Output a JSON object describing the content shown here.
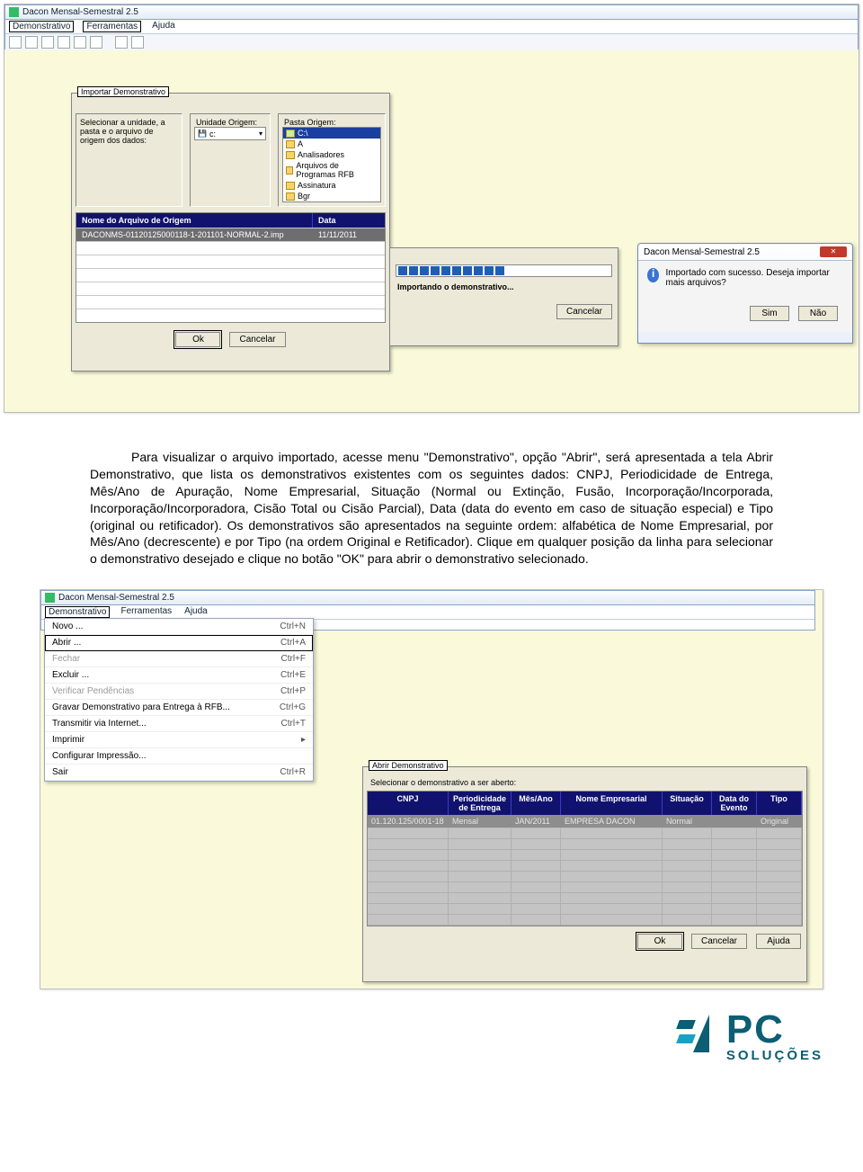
{
  "app": {
    "title": "Dacon Mensal-Semestral 2.5",
    "menus": [
      "Demonstrativo",
      "Ferramentas",
      "Ajuda"
    ]
  },
  "import_dialog": {
    "title": "Importar Demonstrativo",
    "hint": "Selecionar a unidade, a pasta e o arquivo de origem dos dados:",
    "unit_label": "Unidade Origem:",
    "unit_value": "c:",
    "folder_label": "Pasta Origem:",
    "folders": [
      "C:\\",
      "A",
      "Analisadores",
      "Arquivos de Programas RFB",
      "Assinatura",
      "Bgr"
    ],
    "table_headers": [
      "Nome do Arquivo de Origem",
      "Data"
    ],
    "file_name": "DACONMS-01120125000118-1-201101-NORMAL-2.imp",
    "file_date": "11/11/2011",
    "ok": "Ok",
    "cancel": "Cancelar"
  },
  "progress_dialog": {
    "status": "Importando o demonstrativo...",
    "cancel": "Cancelar"
  },
  "result_dialog": {
    "title": "Dacon Mensal-Semestral 2.5",
    "message": "Importado com sucesso. Deseja importar mais arquivos?",
    "yes": "Sim",
    "no": "Não"
  },
  "paragraph": "Para visualizar o arquivo importado, acesse menu \"Demonstrativo\", opção \"Abrir\", será apresentada a tela Abrir Demonstrativo, que lista os demonstrativos existentes com os seguintes dados: CNPJ, Periodicidade de Entrega, Mês/Ano de Apuração, Nome Empresarial, Situação (Normal ou Extinção, Fusão, Incorporação/Incorporada, Incorporação/Incorporadora, Cisão Total ou Cisão Parcial), Data (data do evento em caso de situação especial) e Tipo (original ou retificador). Os demonstrativos são apresentados na seguinte ordem: alfabética de Nome Empresarial, por Mês/Ano (decrescente) e por Tipo (na ordem Original e Retificador). Clique em qualquer posição da linha para selecionar o demonstrativo desejado e clique no botão \"OK\" para abrir o demonstrativo selecionado.",
  "menu_popup": {
    "items": [
      {
        "label": "Novo ...",
        "shortcut": "Ctrl+N",
        "disabled": false
      },
      {
        "label": "Abrir ...",
        "shortcut": "Ctrl+A",
        "disabled": false,
        "boxed": true
      },
      {
        "label": "Fechar",
        "shortcut": "Ctrl+F",
        "disabled": true
      },
      {
        "label": "Excluir ...",
        "shortcut": "Ctrl+E",
        "disabled": false
      },
      {
        "label": "Verificar Pendências",
        "shortcut": "Ctrl+P",
        "disabled": true
      },
      {
        "label": "Gravar Demonstrativo para Entrega à RFB...",
        "shortcut": "Ctrl+G",
        "disabled": false
      },
      {
        "label": "Transmitir via Internet...",
        "shortcut": "Ctrl+T",
        "disabled": false
      },
      {
        "label": "Imprimir",
        "shortcut": "▸",
        "disabled": false
      },
      {
        "label": "Configurar Impressão...",
        "shortcut": "",
        "disabled": false
      },
      {
        "label": "Sair",
        "shortcut": "Ctrl+R",
        "disabled": false
      }
    ]
  },
  "open_dialog": {
    "title": "Abrir Demonstrativo",
    "hint": "Selecionar o demonstrativo a ser aberto:",
    "headers": [
      "CNPJ",
      "Periodicidade de Entrega",
      "Mês/Ano",
      "Nome Empresarial",
      "Situação",
      "Data do Evento",
      "Tipo"
    ],
    "row": {
      "cnpj": "01.120.125/0001-18",
      "period": "Mensal",
      "mesano": "JAN/2011",
      "nome": "EMPRESA DACON",
      "sit": "Normal",
      "data": "",
      "tipo": "Original"
    },
    "ok": "Ok",
    "cancel": "Cancelar",
    "help": "Ajuda"
  },
  "logo": {
    "brand": "PC",
    "sub": "SOLUÇÕES"
  }
}
